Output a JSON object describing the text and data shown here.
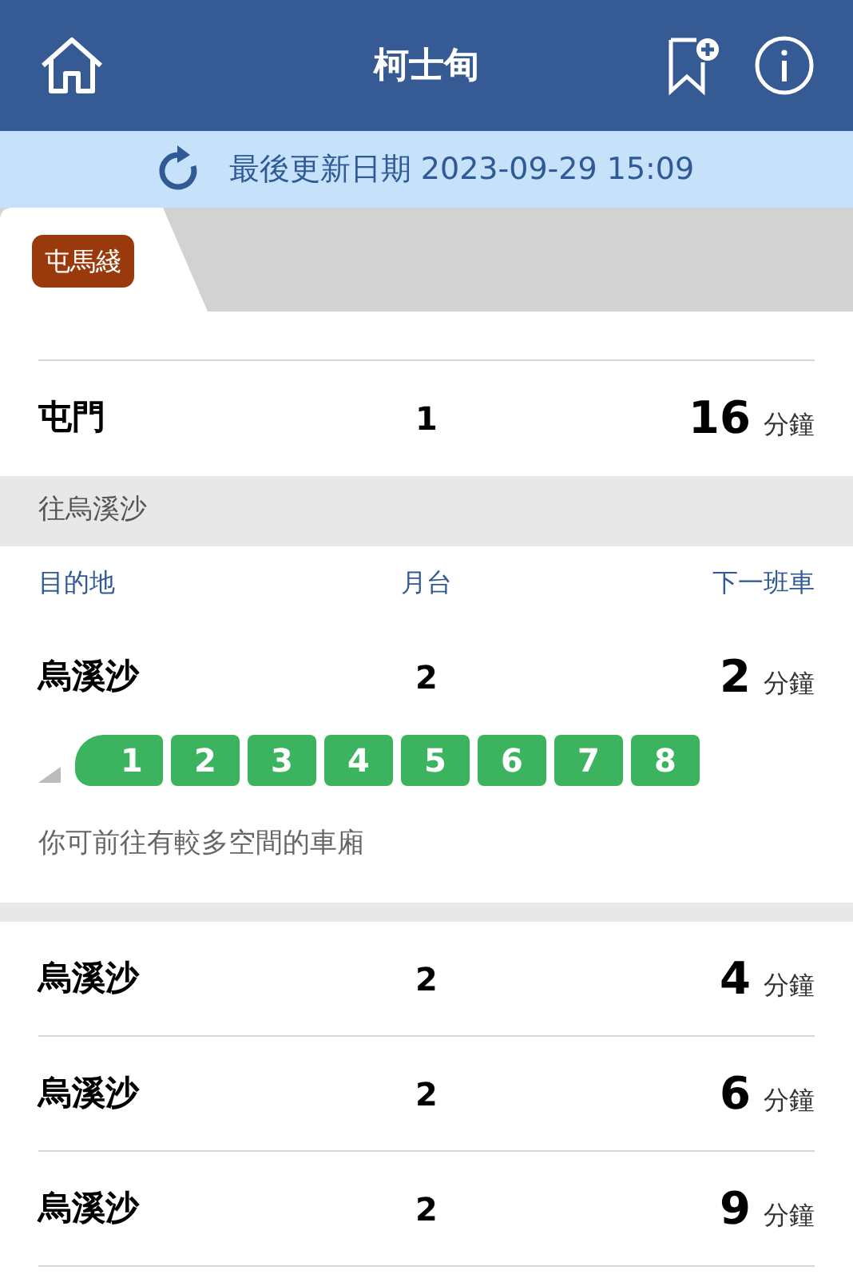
{
  "header": {
    "title": "柯士甸"
  },
  "update_bar": {
    "text": "最後更新日期 2023-09-29 15:09"
  },
  "line_tab": {
    "label": "屯馬綫",
    "color": "#9a3a0c",
    "selected": true
  },
  "upper_rows": [
    {
      "destination": "屯門",
      "platform": "1",
      "minutes": "16",
      "unit": "分鐘"
    }
  ],
  "section": {
    "title": "往烏溪沙"
  },
  "columns": [
    "目的地",
    "月台",
    "下一班車"
  ],
  "first_train": {
    "destination": "烏溪沙",
    "platform": "2",
    "minutes": "2",
    "unit": "分鐘",
    "cars": [
      {
        "label": "1",
        "color": "#3cb35e"
      },
      {
        "label": "2",
        "color": "#3cb35e"
      },
      {
        "label": "3",
        "color": "#3cb35e"
      },
      {
        "label": "4",
        "color": "#3cb35e"
      },
      {
        "label": "5",
        "color": "#3cb35e"
      },
      {
        "label": "6",
        "color": "#3cb35e"
      },
      {
        "label": "7",
        "color": "#3cb35e"
      },
      {
        "label": "8",
        "color": "#3cb35e"
      }
    ],
    "hint": "你可前往有較多空間的車廂"
  },
  "rows": [
    {
      "destination": "烏溪沙",
      "platform": "2",
      "minutes": "4",
      "unit": "分鐘"
    },
    {
      "destination": "烏溪沙",
      "platform": "2",
      "minutes": "6",
      "unit": "分鐘"
    },
    {
      "destination": "烏溪沙",
      "platform": "2",
      "minutes": "9",
      "unit": "分鐘"
    }
  ]
}
